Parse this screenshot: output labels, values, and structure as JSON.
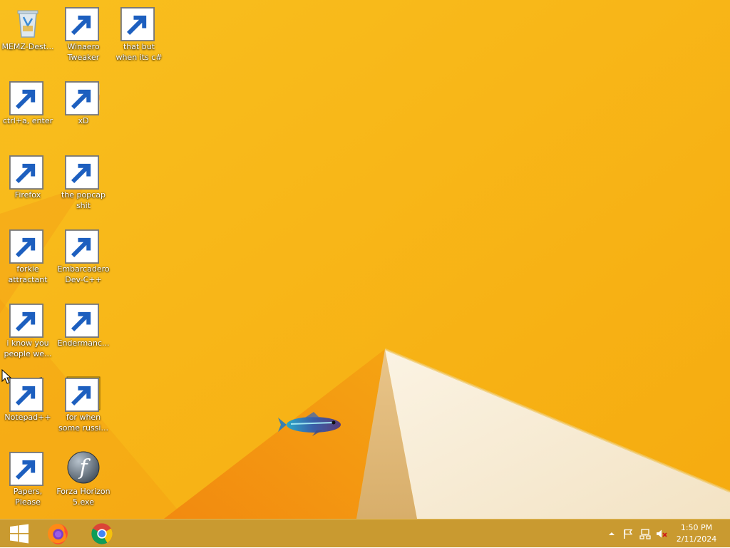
{
  "desktop": {
    "icons": [
      {
        "id": "memz",
        "label": "MEMZ-Dest...",
        "icon": "recycle-bin-icon",
        "shortcut": false
      },
      {
        "id": "winaero",
        "label": "Winaero Tweaker",
        "icon": "winaero-icon",
        "shortcut": true
      },
      {
        "id": "csharp",
        "label": "that but when its c#",
        "icon": "stacked-windows-icon",
        "shortcut": true
      },
      {
        "id": "ctrl-a",
        "label": "ctrl+a, enter",
        "icon": "magnifier-icon",
        "shortcut": true
      },
      {
        "id": "xd",
        "label": "xD",
        "icon": "hxd-icon",
        "shortcut": true
      },
      {
        "id": "firefox",
        "label": "Firefox",
        "icon": "firefox-icon",
        "shortcut": true
      },
      {
        "id": "popcap",
        "label": "the popcap shit",
        "icon": "folder-icon",
        "shortcut": true
      },
      {
        "id": "forkie",
        "label": "forkie attractant",
        "icon": "monitor-gears-icon",
        "shortcut": true
      },
      {
        "id": "devcpp",
        "label": "Embarcadero Dev-C++",
        "icon": "devcpp-icon",
        "shortcut": true
      },
      {
        "id": "chrome",
        "label": "i know you people we...",
        "icon": "chrome-icon",
        "shortcut": true
      },
      {
        "id": "enderman",
        "label": "Endermanc...",
        "icon": "window-app-icon",
        "shortcut": true
      },
      {
        "id": "notepadpp",
        "label": "Notepad++",
        "icon": "notepadpp-icon",
        "shortcut": true
      },
      {
        "id": "russian",
        "label": "for when some russi...",
        "icon": "de-icon",
        "shortcut": true
      },
      {
        "id": "papers",
        "label": "Papers, Please",
        "icon": "papers-please-icon",
        "shortcut": true
      },
      {
        "id": "forza",
        "label": "Forza Horizon 5.exe",
        "icon": "flash-icon",
        "shortcut": true
      }
    ]
  },
  "taskbar": {
    "start_icon": "windows-logo-icon",
    "pinned": [
      {
        "id": "firefox",
        "icon": "firefox-icon"
      },
      {
        "id": "chrome",
        "icon": "chrome-icon"
      }
    ],
    "tray": {
      "icons": [
        "show-hidden-icons-chevron",
        "action-center-flag-icon",
        "network-icon",
        "volume-muted-icon"
      ],
      "time": "1:50 PM",
      "date": "2/11/2024"
    }
  },
  "colors": {
    "wallpaper_base": "#f7b417",
    "taskbar": "#c99a30",
    "label_text": "#ffffff"
  }
}
